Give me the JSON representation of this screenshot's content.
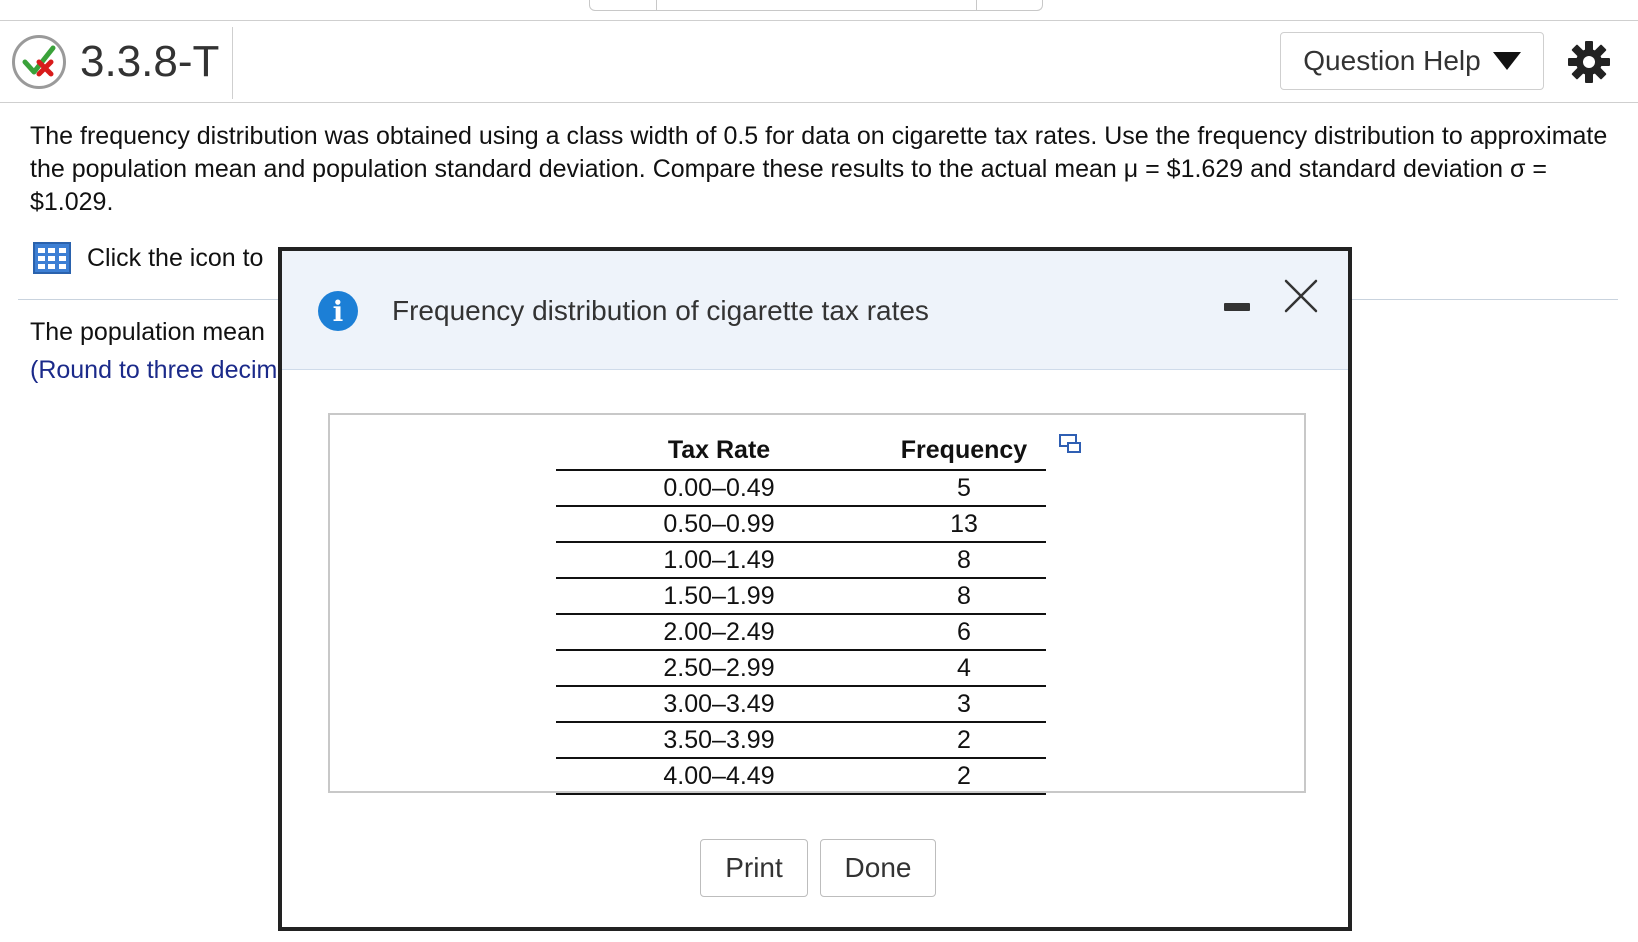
{
  "header": {
    "question_id": "3.3.8-T",
    "help_label": "Question Help"
  },
  "question": {
    "text": "The frequency distribution was obtained using a class width of 0.5 for data on cigarette tax rates. Use the frequency distribution to approximate the population mean and population standard deviation. Compare these results to the actual mean μ = $1.629 and standard deviation σ = $1.029.",
    "click_icon_text": "Click the icon to",
    "population_mean_text": "The population mean",
    "round_hint": "(Round to three decim"
  },
  "modal": {
    "title": "Frequency distribution of cigarette tax rates",
    "table": {
      "headers": [
        "Tax Rate",
        "Frequency"
      ],
      "rows": [
        [
          "0.00–0.49",
          "5"
        ],
        [
          "0.50–0.99",
          "13"
        ],
        [
          "1.00–1.49",
          "8"
        ],
        [
          "1.50–1.99",
          "8"
        ],
        [
          "2.00–2.49",
          "6"
        ],
        [
          "2.50–2.99",
          "4"
        ],
        [
          "3.00–3.49",
          "3"
        ],
        [
          "3.50–3.99",
          "2"
        ],
        [
          "4.00–4.49",
          "2"
        ]
      ]
    },
    "print_label": "Print",
    "done_label": "Done"
  },
  "icons": {
    "status": "partially-correct-icon",
    "help_caret": "caret-down-icon",
    "settings": "gear-icon",
    "data_table": "table-icon",
    "info": "info-icon",
    "minimize": "minimize-icon",
    "close": "close-icon",
    "copy": "copy-icon"
  },
  "colors": {
    "info_blue": "#1c7fd6",
    "hint_blue": "#1b2a8a",
    "modal_header_bg": "#eef3fa",
    "check_green": "#3aa23a",
    "x_red": "#d81b1b"
  }
}
